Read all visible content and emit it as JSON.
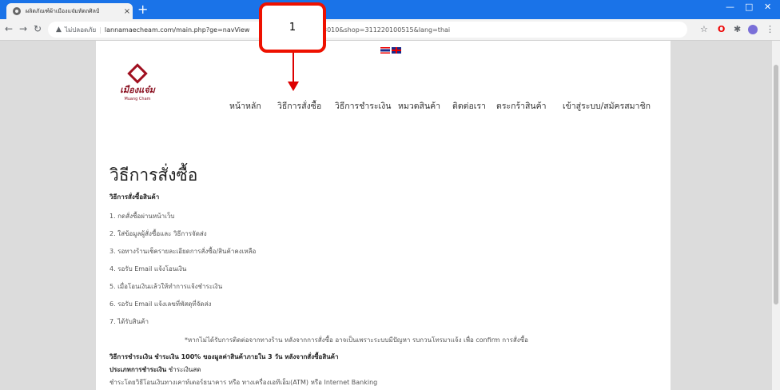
{
  "browser": {
    "tab_title": "ผลิตภัณฑ์ผ้าเมืองแจ๋มหัตถศิลป์",
    "tab_close": "×",
    "new_tab": "+",
    "url_warning": "ไม่ปลอดภัย",
    "url_start": "lannamaecheam.com/main.php?ge=navView",
    "url_end": "3010&shop=311220100515&lang=thai"
  },
  "page": {
    "logo_text": "เมืองแจ๋ม",
    "logo_sub": "Muang Cham",
    "nav": [
      "หน้าหลัก",
      "วิธีการสั่งซื้อ",
      "วิธีการชำระเงิน",
      "หมวดสินค้า",
      "ติดต่อเรา",
      "ตระกร้าสินค้า",
      "เข้าสู่ระบบ/สมัครสมาชิก"
    ],
    "heading": "วิธีการสั่งซื้อ",
    "subheading": "วิธีการสั่งซื้อสินค้า",
    "steps": [
      "1. กดสั่งซื้อผ่านหน้าเว็บ",
      "2. ใส่ข้อมูลผู้สั่งซื้อและ วิธีการจัดส่ง",
      "3. รอทางร้านเช็ครายละเอียดการสั่งซื้อ/สินค้าคงเหลือ",
      "4. รอรับ Email แจ้งโอนเงิน",
      "5. เมื่อโอนเงินแล้วให้ทำการแจ้งชำระเงิน",
      "6. รอรับ Email แจ้งเลขที่พัสดุที่จัดส่ง",
      "7. ได้รับสินค้า"
    ],
    "note": "*หากไม่ได้รับการติดต่อจากทางร้าน หลังจากการสั่งซื้อ อาจเป็นเพราะระบบมีปัญหา รบกวนโทรมาแจ้ง เพื่อ confirm การสั่งซื้อ",
    "pay_label": "วิธีการชำระเงิน",
    "pay_text": "ชำระเงิน 100% ของมูลค่าสินค้าภายใน 3 วัน หลังจากสั่งซื้อสินค้า",
    "paytype_label": "ประเภทการชำระเงิน",
    "paytype_text": "ชำระเงินสด",
    "payhow": "ชำระโดยวิธีโอนเงินทางเคาท์เตอร์ธนาคาร หรือ ทางเครื่องเอทีเอ็ม(ATM) หรือ Internet Banking"
  },
  "annotation": {
    "number": "1"
  }
}
